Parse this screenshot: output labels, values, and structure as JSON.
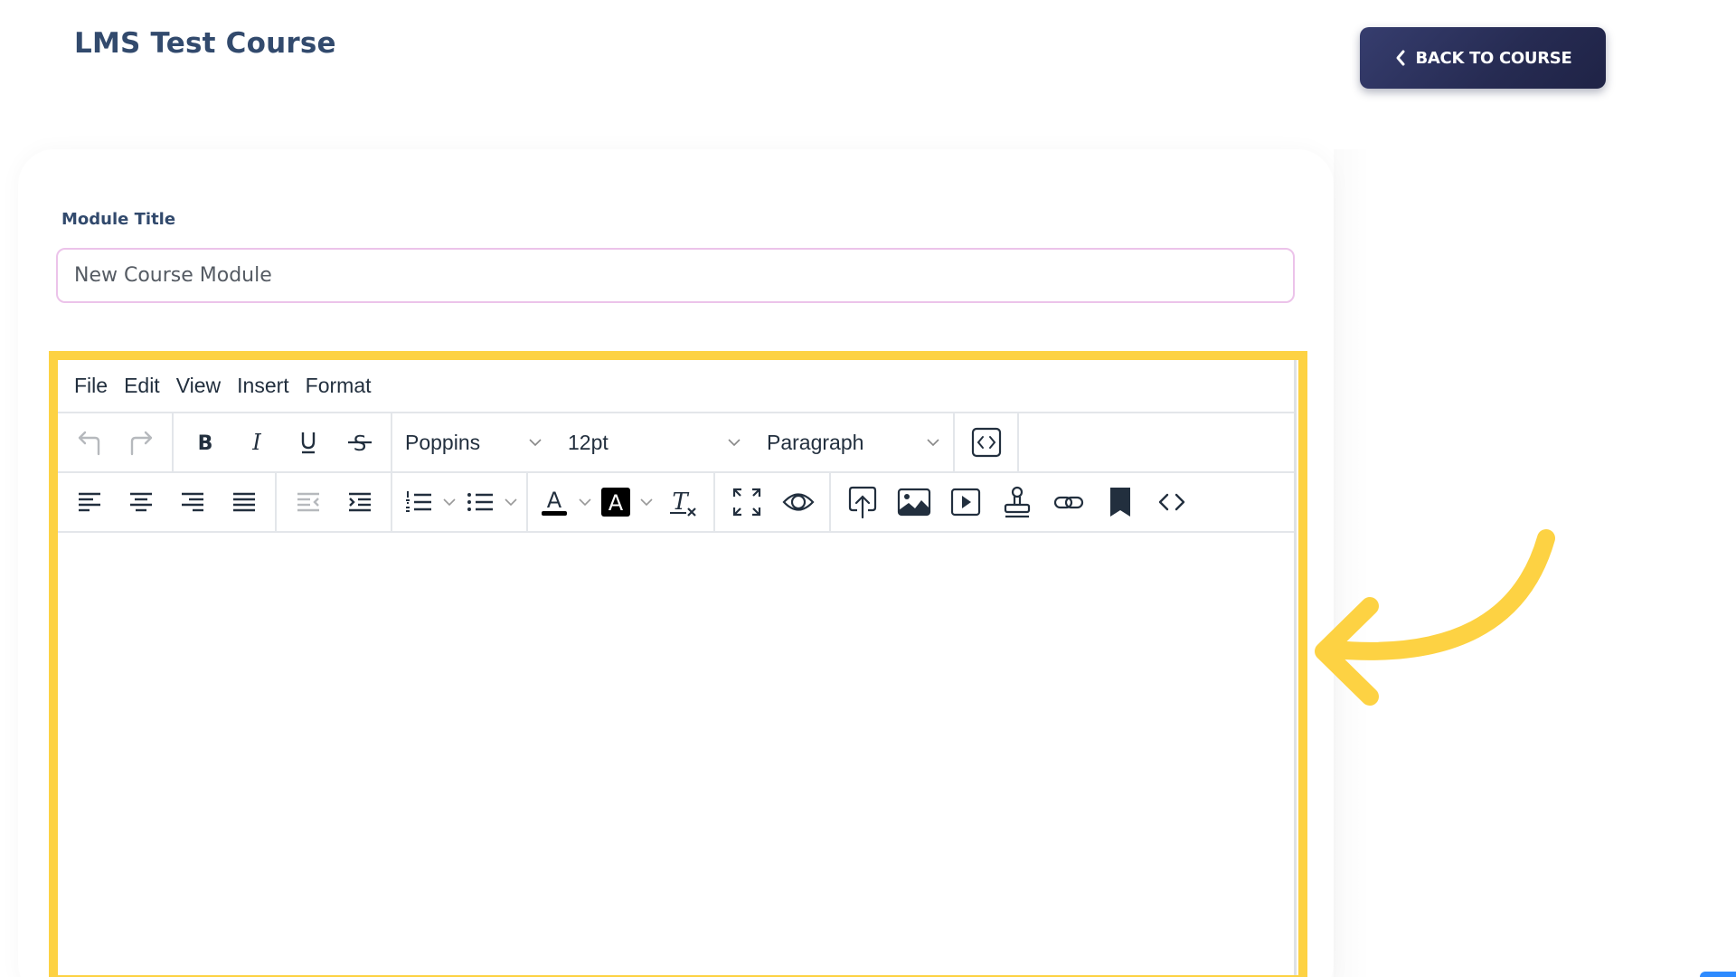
{
  "header": {
    "title": "LMS Test Course",
    "back_button": {
      "label": "BACK TO COURSE",
      "icon": "chevron-left-icon"
    }
  },
  "form": {
    "module_title": {
      "label": "Module Title",
      "value": "New Course Module"
    }
  },
  "editor": {
    "menubar": [
      "File",
      "Edit",
      "View",
      "Insert",
      "Format"
    ],
    "toolbar_row1": {
      "history": [
        "undo-icon",
        "redo-icon"
      ],
      "formatting": [
        "bold-icon",
        "italic-icon",
        "underline-icon",
        "strikethrough-icon"
      ],
      "font_family": "Poppins",
      "font_size": "12pt",
      "block_format": "Paragraph",
      "extra": [
        "source-code-icon"
      ]
    },
    "toolbar_row2": {
      "alignment": [
        "align-left-icon",
        "align-center-icon",
        "align-right-icon",
        "align-justify-icon"
      ],
      "indent": [
        "outdent-icon",
        "indent-icon"
      ],
      "lists": [
        "numbered-list-icon",
        "bullet-list-icon"
      ],
      "colors": [
        "text-color-icon",
        "highlight-color-icon",
        "clear-formatting-icon"
      ],
      "view": [
        "fullscreen-icon",
        "preview-icon"
      ],
      "insert": [
        "upload-icon",
        "image-icon",
        "media-icon",
        "stamp-icon",
        "link-icon",
        "bookmark-icon",
        "code-icon"
      ]
    },
    "content": ""
  },
  "annotation": {
    "highlight_color": "#fdd243",
    "arrow_color": "#fdd243"
  },
  "colors": {
    "title": "#324a6d",
    "button_bg": "#2b3060",
    "input_border": "#ecc3ea"
  }
}
